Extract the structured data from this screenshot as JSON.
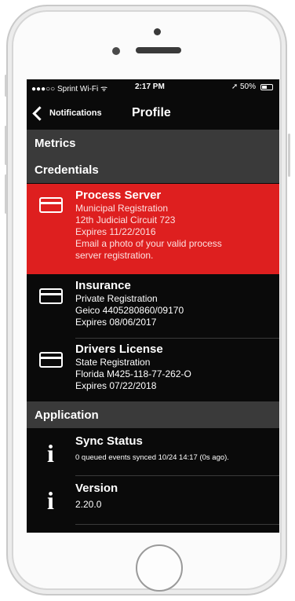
{
  "status_bar": {
    "carrier": "●●●○○ Sprint Wi-Fi ᯤ",
    "time": "2:17 PM",
    "battery": "➚ 50%"
  },
  "navbar": {
    "back_label": "Notifications",
    "title": "Profile"
  },
  "sections": {
    "metrics": "Metrics",
    "credentials": "Credentials",
    "application": "Application"
  },
  "credentials": [
    {
      "title": "Process Server",
      "lines": [
        "Municipal Registration",
        "12th Judicial Circuit 723",
        "Expires 11/22/2016",
        "Email a photo of your valid process",
        "server registration."
      ],
      "icon": "card-icon",
      "highlight": "#de1f1f"
    },
    {
      "title": "Insurance",
      "lines": [
        "Private Registration",
        "Geico 4405280860/09170",
        "Expires 08/06/2017"
      ],
      "icon": "card-icon"
    },
    {
      "title": "Drivers License",
      "lines": [
        "State Registration",
        "Florida M425-118-77-262-O",
        "Expires 07/22/2018"
      ],
      "icon": "card-icon"
    }
  ],
  "application": [
    {
      "title": "Sync Status",
      "lines": [
        "0 queued events synced 10/24 14:17 (0s ago)."
      ],
      "icon": "info-icon",
      "icon_glyph": "i"
    },
    {
      "title": "Version",
      "lines": [
        "2.20.0"
      ],
      "icon": "info-icon",
      "icon_glyph": "i"
    }
  ]
}
